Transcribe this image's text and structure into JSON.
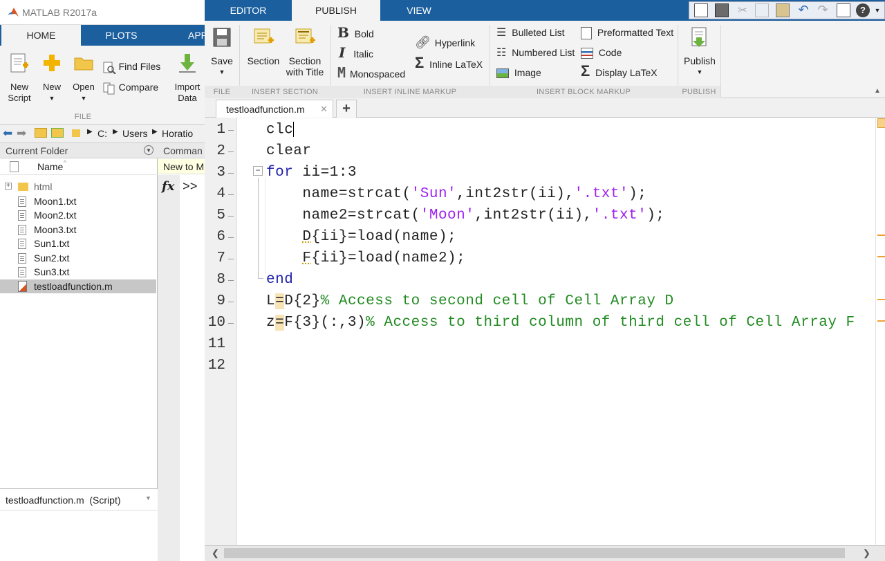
{
  "main_window": {
    "title": "MATLAB R2017a",
    "tabs": [
      {
        "label": "HOME"
      },
      {
        "label": "PLOTS"
      },
      {
        "label": "APP"
      }
    ],
    "ribbon": {
      "new_script": "New\nScript",
      "new": "New",
      "open": "Open",
      "find_files": "Find Files",
      "compare": "Compare",
      "import_data": "Import\nData",
      "group_label": "FILE"
    },
    "address": {
      "path": [
        "C:",
        "Users",
        "Horatio"
      ]
    }
  },
  "current_folder": {
    "title": "Current Folder",
    "column_name": "Name",
    "sort_indicator": "^",
    "items": [
      {
        "name": "html",
        "type": "folder"
      },
      {
        "name": "Moon1.txt",
        "type": "txt"
      },
      {
        "name": "Moon2.txt",
        "type": "txt"
      },
      {
        "name": "Moon3.txt",
        "type": "txt"
      },
      {
        "name": "Sun1.txt",
        "type": "txt"
      },
      {
        "name": "Sun2.txt",
        "type": "txt"
      },
      {
        "name": "Sun3.txt",
        "type": "txt"
      },
      {
        "name": "testloadfunction.m",
        "type": "m",
        "selected": true
      }
    ],
    "details": "testloadfunction.m  (Script)"
  },
  "command_window": {
    "title": "Comman",
    "new_to": "New to M",
    "prompt": ">>",
    "fx": "fx"
  },
  "editor": {
    "tabs": [
      {
        "label": "EDITOR"
      },
      {
        "label": "PUBLISH",
        "active": true
      },
      {
        "label": "VIEW"
      }
    ],
    "ribbon": {
      "save": "Save",
      "section": "Section",
      "section_with_title": "Section\nwith Title",
      "bold": "Bold",
      "italic": "Italic",
      "monospaced": "Monospaced",
      "hyperlink": "Hyperlink",
      "inline_latex": "Inline LaTeX",
      "bulleted_list": "Bulleted List",
      "numbered_list": "Numbered List",
      "image": "Image",
      "preformatted_text": "Preformatted Text",
      "code": "Code",
      "display_latex": "Display LaTeX",
      "publish": "Publish",
      "groups": {
        "file": "FILE",
        "insert_section": "INSERT SECTION",
        "inline_markup": "INSERT INLINE MARKUP",
        "block_markup": "INSERT BLOCK MARKUP",
        "publish": "PUBLISH"
      }
    },
    "doc_tab": "testloadfunction.m",
    "add_tab": "+",
    "close_tab": "✕",
    "line_numbers": [
      "1",
      "2",
      "3",
      "4",
      "5",
      "6",
      "7",
      "8",
      "9",
      "10",
      "11",
      "12"
    ],
    "code_lines": [
      "clc",
      "clear",
      "for ii=1:3",
      "    name=strcat('Sun',int2str(ii),'.txt');",
      "    name2=strcat('Moon',int2str(ii),'.txt');",
      "    D{ii}=load(name);",
      "    F{ii}=load(name2);",
      "end",
      "L=D{2}% Access to second cell of Cell Array D",
      "z=F{3}(:,3)% Access to third column of third cell of Cell Array F",
      "",
      ""
    ]
  },
  "colors": {
    "tab_blue": "#1b5f9e",
    "keyword": "#1f1faa",
    "string": "#a020f0",
    "comment": "#228b22",
    "marker": "#f0a030"
  }
}
